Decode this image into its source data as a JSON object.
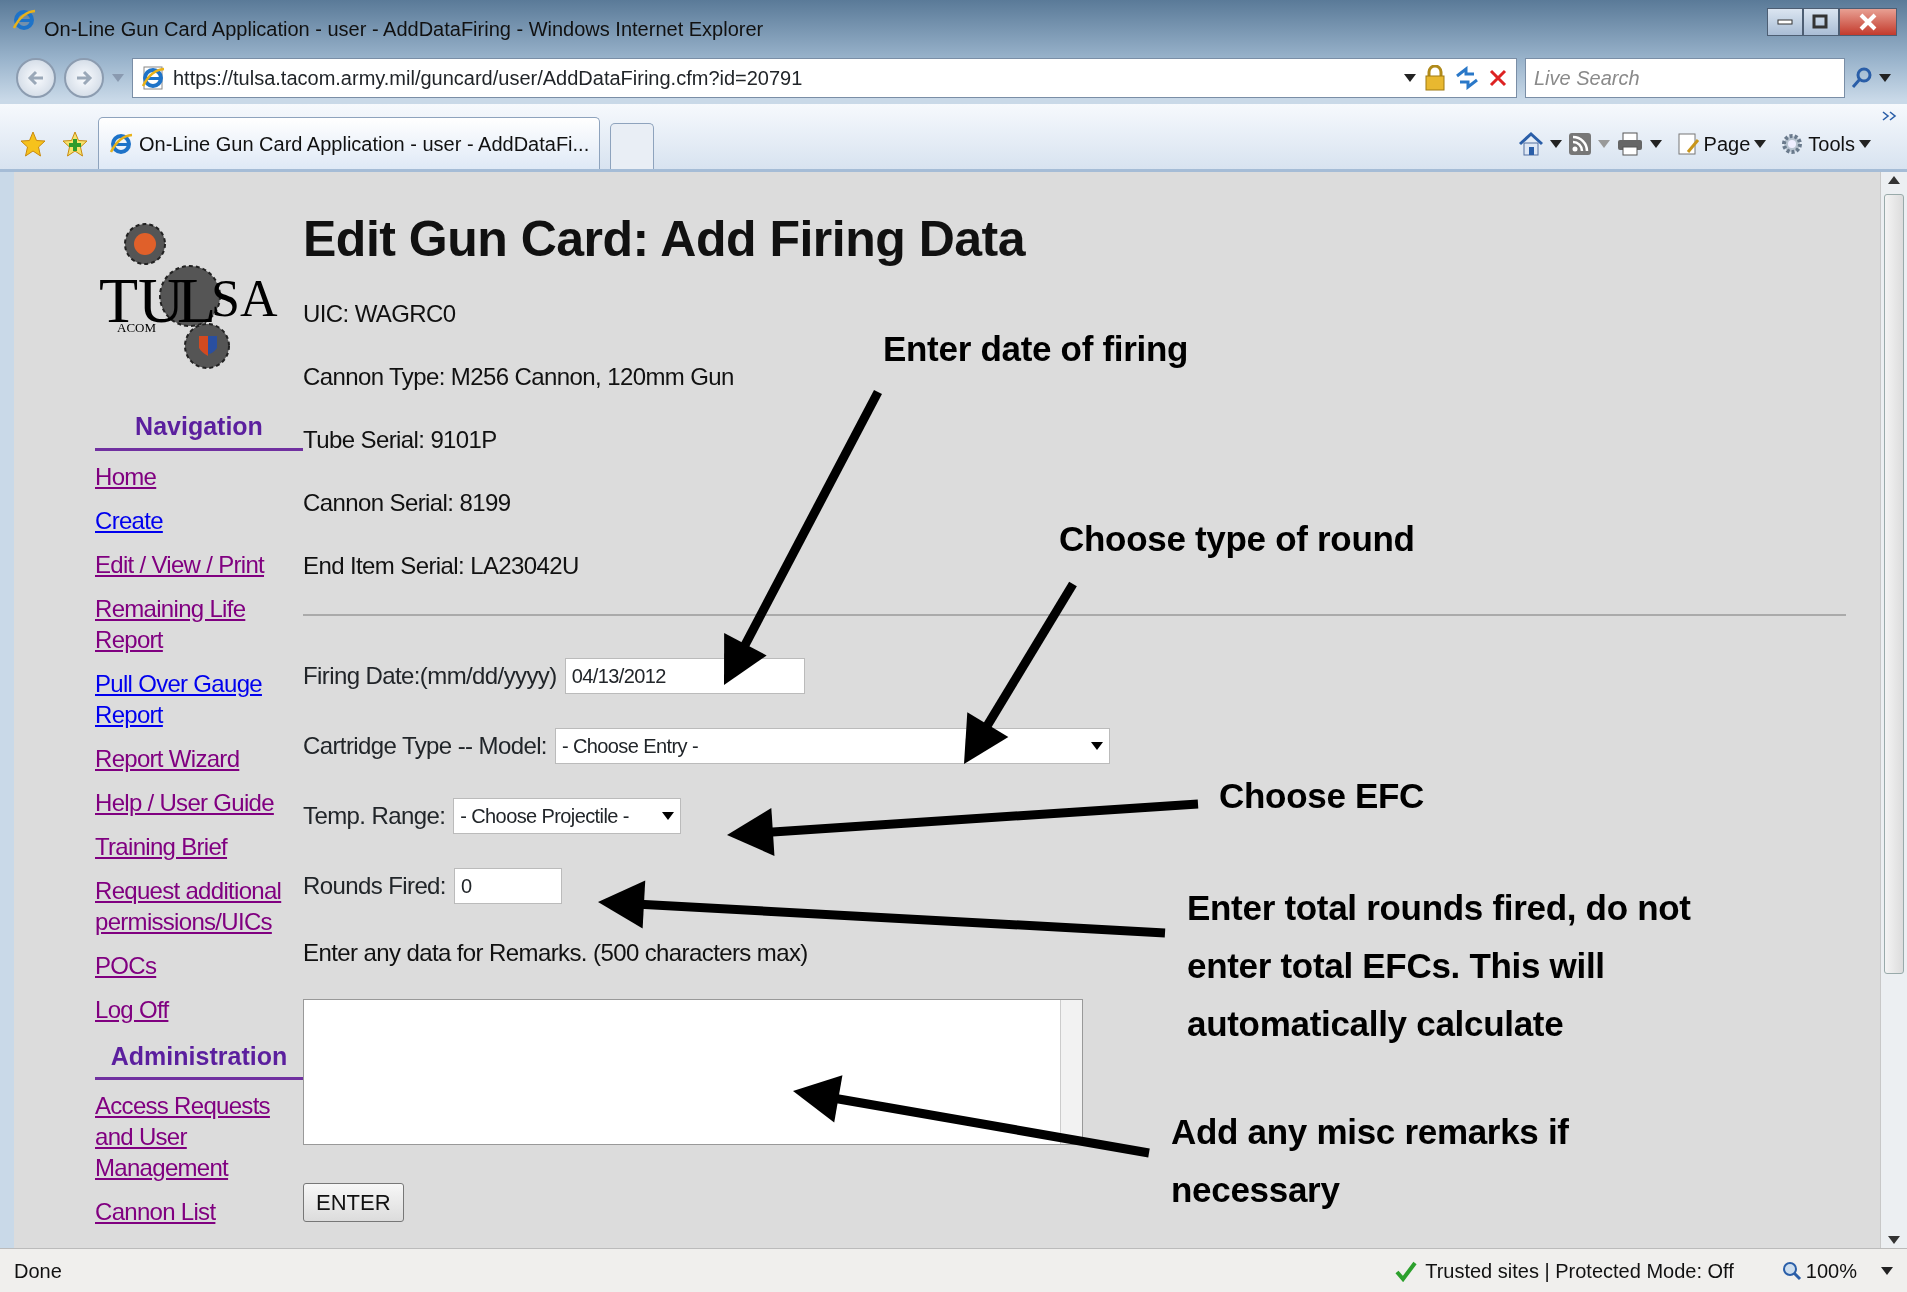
{
  "window": {
    "title": "On-Line Gun Card Application - user - AddDataFiring - Windows Internet Explorer"
  },
  "address_bar": {
    "url": "https://tulsa.tacom.army.mil/guncard/user/AddDataFiring.cfm?id=20791"
  },
  "search": {
    "placeholder": "Live Search"
  },
  "tabs": [
    {
      "label": "On-Line Gun Card Application - user - AddDataFi...",
      "selected": true
    }
  ],
  "command_bar": [
    {
      "label": "Page",
      "kind": "page"
    },
    {
      "label": "Tools",
      "kind": "tools"
    }
  ],
  "logo": {
    "letters": [
      "TU",
      "L",
      "SA"
    ],
    "subtext": "ACOM"
  },
  "sidebar": {
    "sections": [
      {
        "title": "Navigation",
        "links": [
          {
            "label": "Home",
            "visited": true
          },
          {
            "label": "Create",
            "visited": false
          },
          {
            "label": "Edit / View / Print",
            "visited": true
          },
          {
            "label": "Remaining Life Report",
            "visited": true
          },
          {
            "label": "Pull Over Gauge Report",
            "visited": false
          },
          {
            "label": "Report Wizard",
            "visited": true
          },
          {
            "label": "Help / User Guide",
            "visited": true
          },
          {
            "label": "Training Brief",
            "visited": true
          },
          {
            "label": "Request additional permissions/UICs",
            "visited": true
          },
          {
            "label": "POCs",
            "visited": true
          },
          {
            "label": "Log Off",
            "visited": true
          }
        ]
      },
      {
        "title": "Administration",
        "links": [
          {
            "label": "Access Requests and User Management",
            "visited": true
          },
          {
            "label": "Cannon List",
            "visited": true
          }
        ]
      }
    ]
  },
  "page": {
    "heading": "Edit Gun Card: Add Firing Data",
    "details": [
      "UIC: WAGRC0",
      "Cannon Type: M256 Cannon, 120mm Gun",
      "Tube Serial: 9101P",
      "Cannon Serial: 8199",
      "End Item Serial: LA23042U"
    ],
    "fields": [
      {
        "kind": "text",
        "label": "Firing Date:(mm/dd/yyyy)",
        "value": "04/13/2012"
      },
      {
        "kind": "select",
        "label": "Cartridge Type -- Model:",
        "value": "- Choose Entry -"
      },
      {
        "kind": "select",
        "label": "Temp. Range:",
        "value": "- Choose Projectile -"
      },
      {
        "kind": "text",
        "label": "Rounds Fired:",
        "value": "0"
      }
    ],
    "remarks_label": "Enter any data for Remarks. (500 characters max)",
    "submit": "ENTER"
  },
  "annotations": [
    {
      "lines": [
        "Enter date of firing"
      ]
    },
    {
      "lines": [
        "Choose type of round"
      ]
    },
    {
      "lines": [
        "Choose EFC"
      ]
    },
    {
      "lines": [
        "Enter total rounds fired, do not",
        "enter total EFCs. This will",
        "automatically calculate"
      ]
    },
    {
      "lines": [
        "Add any misc remarks if",
        "necessary"
      ]
    }
  ],
  "status_bar": {
    "text": "Done",
    "zone": "Trusted sites | Protected Mode: Off",
    "zoom": "100%"
  }
}
